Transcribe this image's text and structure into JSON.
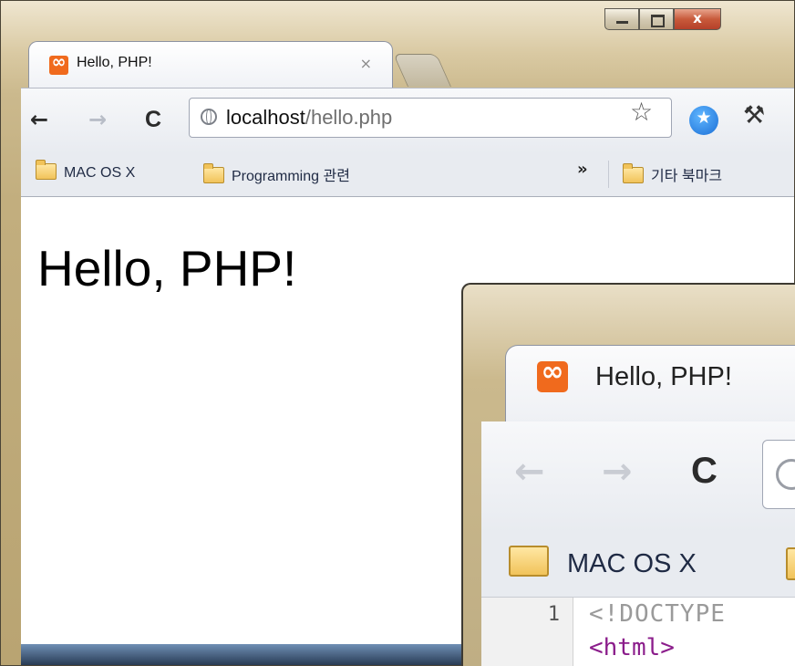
{
  "window": {
    "minimize_label": "",
    "maximize_label": "",
    "close_label": "x"
  },
  "tab": {
    "title": "Hello, PHP!",
    "close": "×"
  },
  "toolbar": {
    "back": "←",
    "forward": "→",
    "reload": "C",
    "url_host": "localhost",
    "url_path": "/hello.php",
    "star": "☆",
    "wrench": "🔧"
  },
  "bookmarks": {
    "items": [
      {
        "label": "MAC OS X"
      },
      {
        "label": "Programming 관련"
      }
    ],
    "overflow": "»",
    "other": "기타 북마크"
  },
  "page": {
    "heading": "Hello, PHP!"
  },
  "zoomed": {
    "tab_title": "Hello, PHP!",
    "back": "←",
    "forward": "→",
    "reload": "C",
    "bookmark": "MAC OS X",
    "line1_no": "1",
    "line1_code": "<!DOCTYPE",
    "line2_code": "<html>"
  },
  "colors": {
    "favicon": "#f06a1d",
    "folder": "#f1c35a",
    "close_button": "#c85a3b",
    "frame": "#cbb98d"
  }
}
